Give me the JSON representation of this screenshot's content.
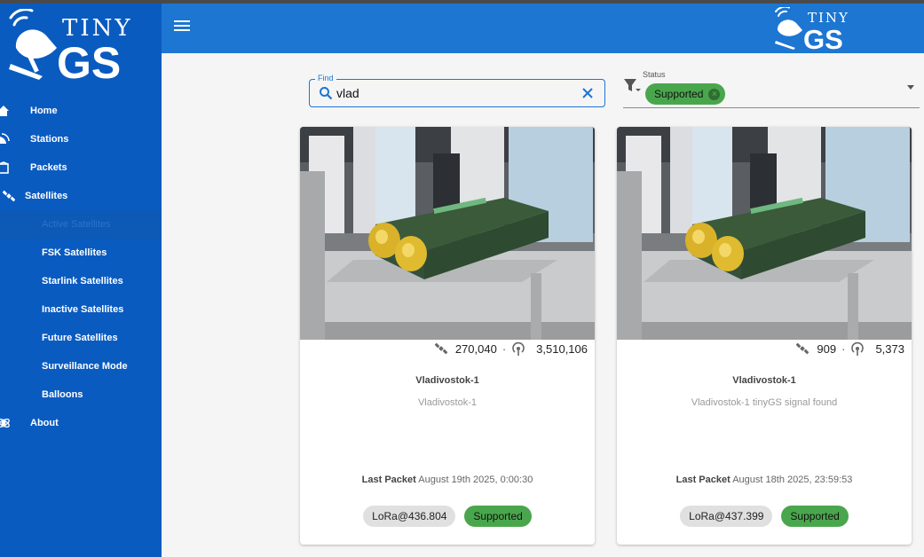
{
  "brand": {
    "logo_text_top": "TINY",
    "logo_text_bottom": "GS"
  },
  "sidebar": {
    "items": [
      {
        "label": "Home",
        "icon": "home-icon"
      },
      {
        "label": "Stations",
        "icon": "satellite-dish-icon"
      },
      {
        "label": "Packets",
        "icon": "package-icon"
      },
      {
        "label": "Satellites",
        "icon": "satellite-icon"
      },
      {
        "label": "Active Satellites"
      },
      {
        "label": "FSK Satellites"
      },
      {
        "label": "Starlink Satellites"
      },
      {
        "label": "Inactive Satellites"
      },
      {
        "label": "Future Satellites"
      },
      {
        "label": "Surveillance Mode"
      },
      {
        "label": "Balloons"
      },
      {
        "label": "About",
        "icon": "orbit-icon"
      }
    ]
  },
  "filters": {
    "find_label": "Find",
    "find_value": "vlad",
    "status_label": "Status",
    "status_value": "Supported",
    "status_color": "#4aa64d"
  },
  "cards": [
    {
      "stat1": "270,040",
      "stat2": "3,510,106",
      "dot": "·",
      "title": "Vladivostok-1",
      "subtitle": "Vladivostok-1",
      "last_label": "Last Packet",
      "last_value": "August 19th 2025, 0:00:30",
      "freq": "LoRa@436.804",
      "status": "Supported"
    },
    {
      "stat1": "909",
      "stat2": "5,373",
      "dot": "·",
      "title": "Vladivostok-1",
      "subtitle": "Vladivostok-1 tinyGS signal found",
      "last_label": "Last Packet",
      "last_value": "August 18th 2025, 23:59:53",
      "freq": "LoRa@437.399",
      "status": "Supported"
    }
  ],
  "colors": {
    "sidebar": "#0a5bc0",
    "appbar": "#1c76d2",
    "chip_green": "#4aa64d"
  }
}
